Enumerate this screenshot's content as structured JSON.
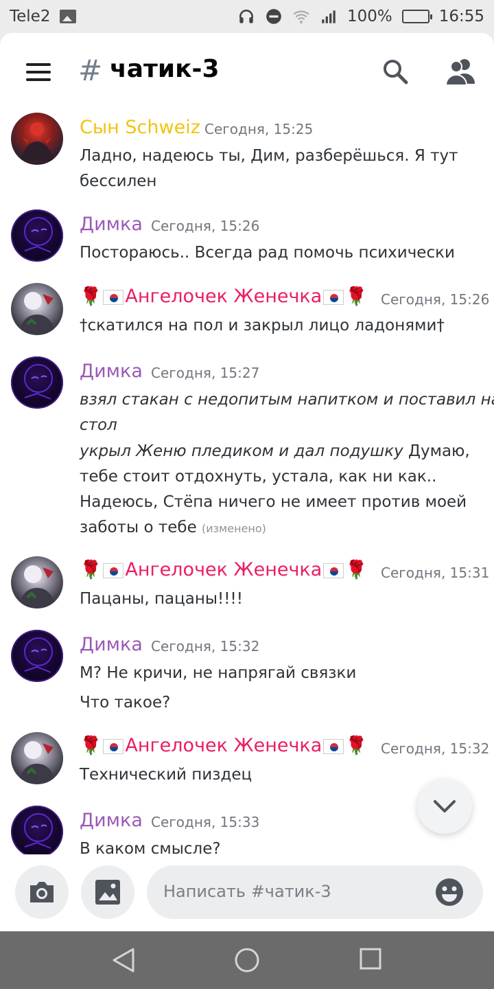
{
  "status_bar": {
    "carrier": "Tele2",
    "battery": "100%",
    "time": "16:55"
  },
  "header": {
    "hash": "#",
    "channel_name": "чатик-3"
  },
  "messages": [
    {
      "author": "Сын Schweiz",
      "author_color": "#f1c40f",
      "timestamp": "Сегодня, 15:25",
      "lines": [
        "Ладно, надеюсь ты, Дим, разберёшься. Я тут",
        "бессилен"
      ]
    },
    {
      "author": "Димка",
      "author_color": "#9b59b6",
      "timestamp": "Сегодня, 15:26",
      "lines": [
        "Постораюсь.. Всегда рад помочь психически"
      ]
    },
    {
      "author": "Ангелочек Женечка",
      "author_color": "#e91e63",
      "timestamp": "Сегодня, 15:26",
      "lines": [
        "†скатился на пол и закрыл лицо ладонями†"
      ]
    },
    {
      "author": "Димка",
      "author_color": "#9b59b6",
      "timestamp": "Сегодня, 15:27",
      "lines": [
        "взял стакан с недопитым напитком и поставил на",
        "стол",
        "укрыл Женю пледиком и дал подушку",
        " Думаю,",
        "тебе стоит отдохнуть, устала, как ни как..",
        "Надеюсь, Стёпа ничего не имеет против моей",
        "заботы о тебе"
      ],
      "edited": "(изменено)"
    },
    {
      "author": "Ангелочек Женечка",
      "author_color": "#e91e63",
      "timestamp": "Сегодня, 15:31",
      "lines": [
        "Пацаны, пацаны!!!!"
      ]
    },
    {
      "author": "Димка",
      "author_color": "#9b59b6",
      "timestamp": "Сегодня, 15:32",
      "lines": [
        "М? Не кричи, не напрягай связки",
        "Что такое?"
      ]
    },
    {
      "author": "Ангелочек Женечка",
      "author_color": "#e91e63",
      "timestamp": "Сегодня, 15:32",
      "lines": [
        "Технический пиздец"
      ]
    },
    {
      "author": "Димка",
      "author_color": "#9b59b6",
      "timestamp": "Сегодня, 15:33",
      "lines": [
        "В каком смысле?"
      ]
    }
  ],
  "composer": {
    "placeholder": "Написать #чатик-3"
  },
  "decor": {
    "rose": "🌹"
  }
}
